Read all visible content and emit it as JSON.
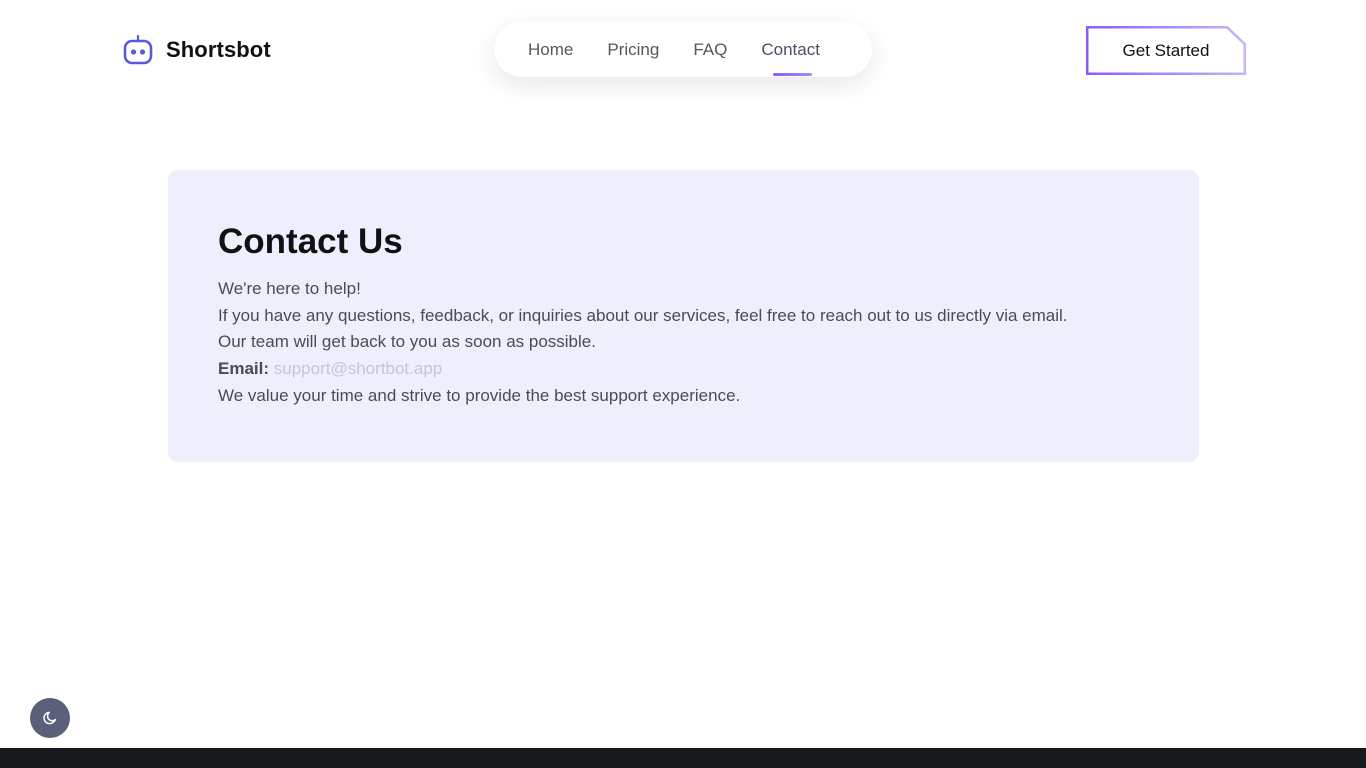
{
  "brand": {
    "name": "Shortsbot",
    "icon": "robot-icon",
    "accent_color": "#5b5bd6"
  },
  "nav": {
    "items": [
      {
        "label": "Home",
        "active": false
      },
      {
        "label": "Pricing",
        "active": false
      },
      {
        "label": "FAQ",
        "active": false
      },
      {
        "label": "Contact",
        "active": true
      }
    ],
    "active_indicator_color": "#8b5cf6"
  },
  "header": {
    "cta_label": "Get Started",
    "cta_border_color": "#8b5cf6"
  },
  "contact": {
    "title": "Contact Us",
    "intro": "We're here to help!",
    "body_line1": "If you have any questions, feedback, or inquiries about our services, feel free to reach out to us directly via email.",
    "body_line2": "Our team will get back to you as soon as possible.",
    "email_label": "Email:",
    "email_value": "support@shortbot.app",
    "closing": "We value your time and strive to provide the best support experience.",
    "card_background": "#eeeffd"
  },
  "theme_toggle": {
    "icon": "moon-icon",
    "background": "#5a5f7a"
  },
  "footer": {
    "background": "#17181c"
  }
}
